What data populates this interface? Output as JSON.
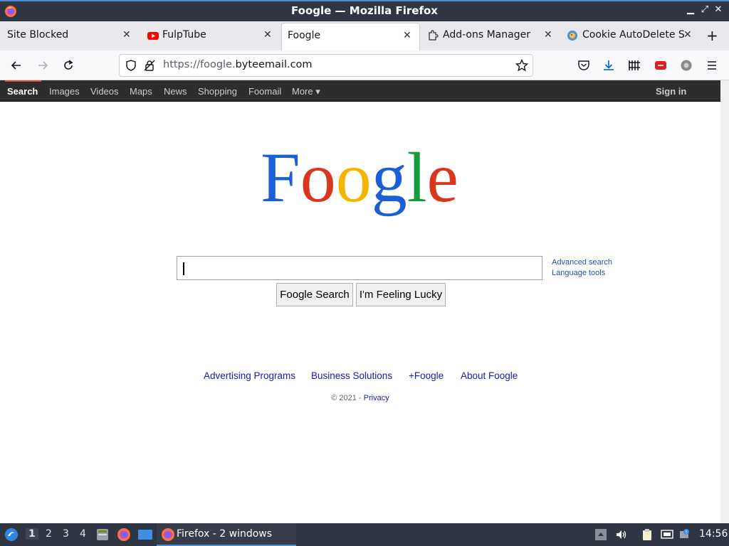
{
  "window": {
    "title": "Foogle — Mozilla Firefox"
  },
  "tabs": [
    {
      "label": "Site Blocked",
      "icon": "none",
      "active": false
    },
    {
      "label": "FulpTube",
      "icon": "youtube-icon",
      "active": false
    },
    {
      "label": "Foogle",
      "icon": "none",
      "active": true
    },
    {
      "label": "Add-ons Manager",
      "icon": "puzzle-icon",
      "active": false
    },
    {
      "label": "Cookie AutoDelete S",
      "icon": "cookie-icon",
      "active": false
    }
  ],
  "navbar": {
    "url_prefix": "https://foogle.",
    "url_domain": "byteemail.com"
  },
  "gbar": {
    "items": [
      "Search",
      "Images",
      "Videos",
      "Maps",
      "News",
      "Shopping",
      "Foomail",
      "More ▾"
    ],
    "active": "Search",
    "signin": "Sign in"
  },
  "page": {
    "logo_letters": [
      "F",
      "o",
      "o",
      "g",
      "l",
      "e"
    ],
    "logo_colors": [
      "#1a5fd6",
      "#d9351f",
      "#f4b400",
      "#1a5fd6",
      "#129c3c",
      "#d9351f"
    ],
    "search_value": "",
    "advanced_search": "Advanced search",
    "language_tools": "Language tools",
    "search_button": "Foogle Search",
    "lucky_button": "I'm Feeling Lucky",
    "footer_links": [
      "Advertising Programs",
      "Business Solutions",
      "+Foogle",
      "About Foogle"
    ],
    "copyright": "© 2021 - ",
    "privacy": "Privacy"
  },
  "taskbar": {
    "workspaces": [
      "1",
      "2",
      "3",
      "4"
    ],
    "active_workspace": "1",
    "task_label": "Firefox - 2 windows",
    "clock": "14:56"
  },
  "colors": {
    "titlebar": "#2f3542",
    "accent": "#4a8fd6",
    "gbar": "#2d2d2d",
    "link": "#1a1aa6"
  }
}
